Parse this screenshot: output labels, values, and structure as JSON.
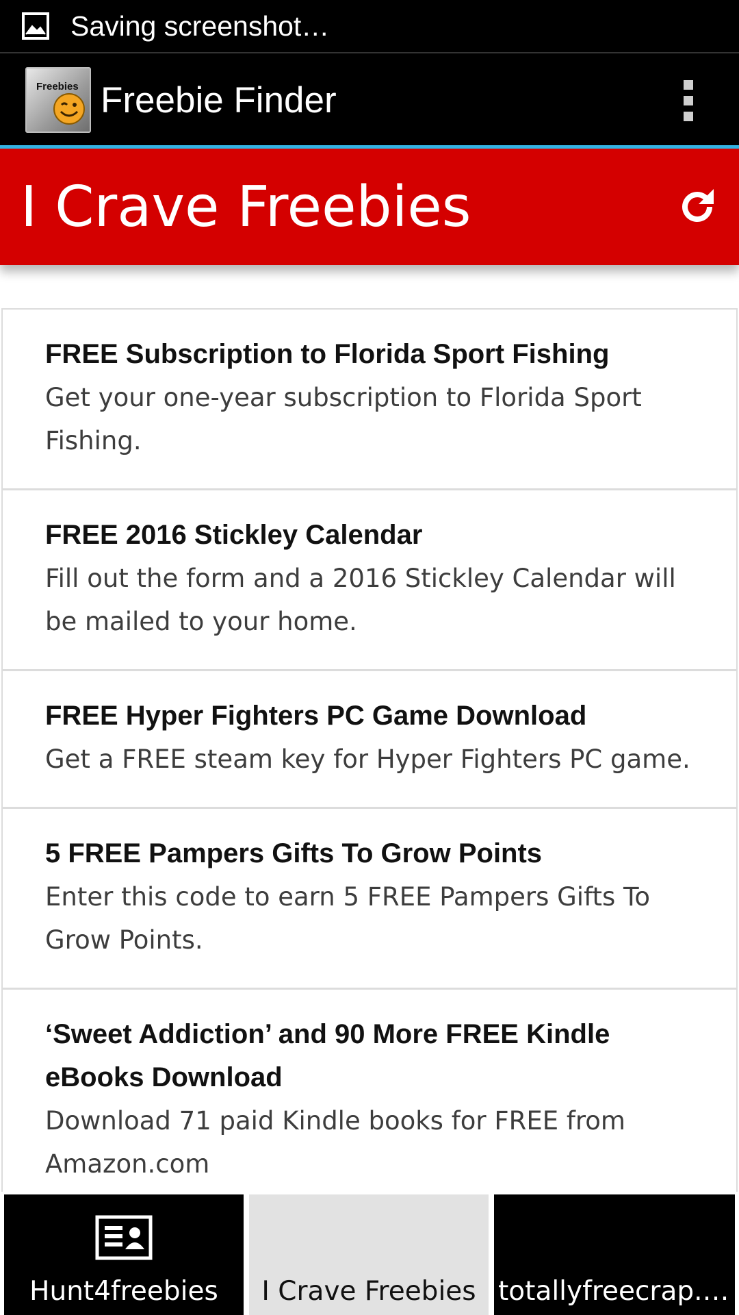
{
  "status_bar": {
    "notification_icon": "image-icon",
    "text": "Saving screenshot…"
  },
  "action_bar": {
    "logo_icon": "freebies-smiley-logo",
    "logo_text": "Freebies",
    "title": "Freebie Finder",
    "menu_icon": "overflow-menu-icon"
  },
  "header": {
    "title": "I Crave Freebies",
    "refresh_icon": "refresh-icon",
    "background_color": "#d40000"
  },
  "items": [
    {
      "title": "FREE Subscription to Florida Sport Fishing",
      "description": "Get your one-year subscription to Florida Sport Fishing."
    },
    {
      "title": "FREE 2016 Stickley Calendar",
      "description": "Fill out the form and a 2016 Stickley Calendar will be mailed to your home."
    },
    {
      "title": "FREE Hyper Fighters PC Game Download",
      "description": "Get a FREE steam key for Hyper Fighters PC game."
    },
    {
      "title": "5 FREE Pampers Gifts To Grow Points",
      "description": "Enter this code to earn 5 FREE Pampers Gifts To Grow Points."
    },
    {
      "title": "‘Sweet Addiction’ and 90 More FREE Kindle eBooks Download",
      "description": "Download 71 paid Kindle books for FREE from Amazon.com"
    }
  ],
  "tabs": [
    {
      "label": "Hunt4freebies",
      "icon": "contact-card-icon",
      "selected": false
    },
    {
      "label": "I Crave Freebies",
      "selected": true
    },
    {
      "label": "totallyfreecrap.c…",
      "selected": false
    }
  ],
  "colors": {
    "accent": "#33b5e5",
    "header_red": "#d40000",
    "bar_black": "#000000",
    "tab_selected": "#e2e2e2"
  }
}
